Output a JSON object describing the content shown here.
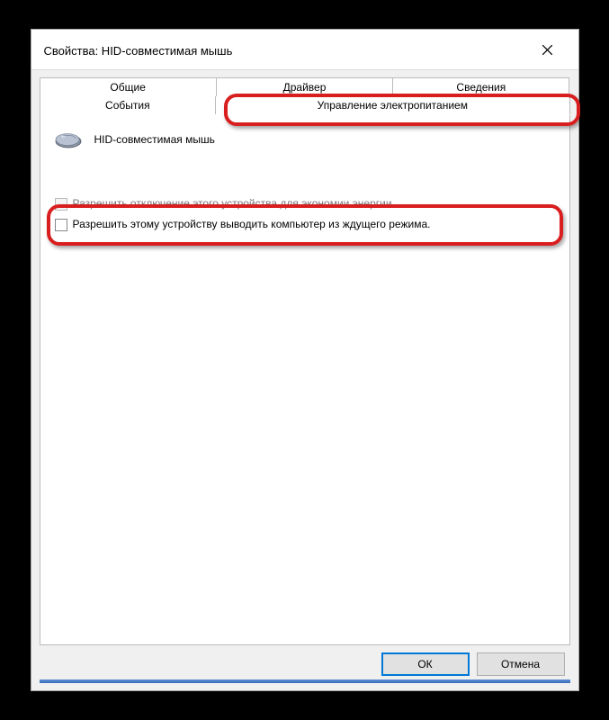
{
  "title": "Свойства: HID-совместимая мышь",
  "tabs": {
    "general": "Общие",
    "driver": "Драйвер",
    "details": "Сведения",
    "events": "События",
    "power": "Управление электропитанием"
  },
  "device": {
    "name": "HID-совместимая мышь"
  },
  "options": {
    "allowOff": "Разрешить отключение этого устройства для экономии энергии.",
    "allowWake": "Разрешить этому устройству выводить компьютер из ждущего режима."
  },
  "buttons": {
    "ok": "ОК",
    "cancel": "Отмена"
  }
}
